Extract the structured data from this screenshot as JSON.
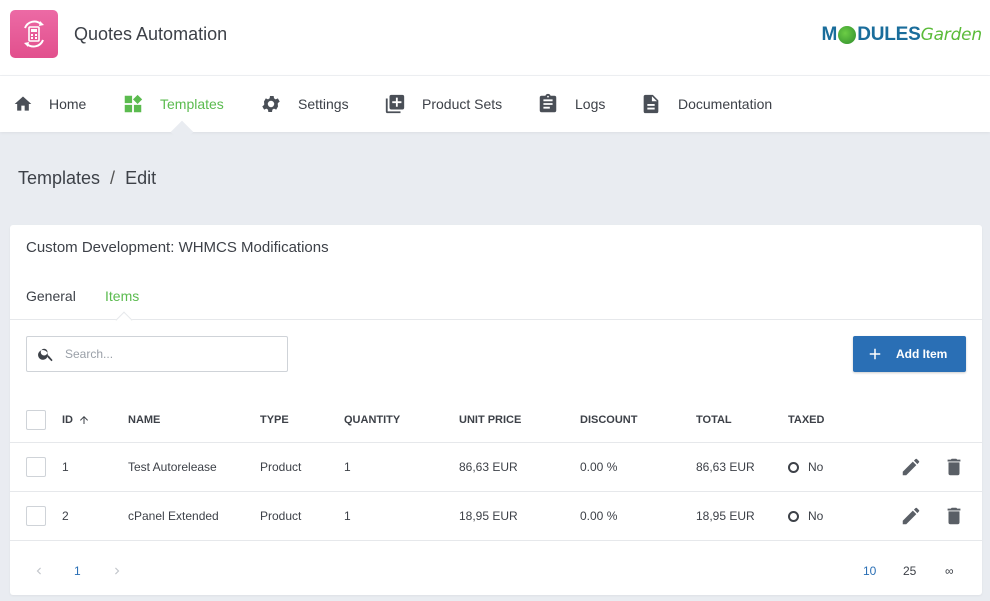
{
  "app": {
    "title": "Quotes Automation",
    "brand_left": "M",
    "brand_mid": "DULES",
    "brand_right": "Garden"
  },
  "nav": [
    {
      "label": "Home",
      "icon": "home-icon",
      "active": false
    },
    {
      "label": "Templates",
      "icon": "templates-icon",
      "active": true
    },
    {
      "label": "Settings",
      "icon": "gear-icon",
      "active": false
    },
    {
      "label": "Product Sets",
      "icon": "library-add-icon",
      "active": false
    },
    {
      "label": "Logs",
      "icon": "clipboard-icon",
      "active": false
    },
    {
      "label": "Documentation",
      "icon": "document-icon",
      "active": false
    }
  ],
  "breadcrumb": {
    "parent": "Templates",
    "separator": "/",
    "current": "Edit"
  },
  "card": {
    "title": "Custom Development: WHMCS Modifications",
    "tabs": [
      {
        "label": "General",
        "active": false
      },
      {
        "label": "Items",
        "active": true
      }
    ]
  },
  "search": {
    "placeholder": "Search...",
    "value": ""
  },
  "add_button": {
    "label": "Add Item"
  },
  "table": {
    "columns": [
      "ID",
      "NAME",
      "TYPE",
      "QUANTITY",
      "UNIT PRICE",
      "DISCOUNT",
      "TOTAL",
      "TAXED"
    ],
    "rows": [
      {
        "id": "1",
        "name": "Test Autorelease",
        "type": "Product",
        "quantity": "1",
        "unit_price": "86,63 EUR",
        "discount": "0.00 %",
        "total": "86,63 EUR",
        "taxed": "No"
      },
      {
        "id": "2",
        "name": "cPanel Extended",
        "type": "Product",
        "quantity": "1",
        "unit_price": "18,95 EUR",
        "discount": "0.00 %",
        "total": "18,95 EUR",
        "taxed": "No"
      }
    ]
  },
  "pagination": {
    "current_page": "1",
    "page_sizes": [
      "10",
      "25",
      "∞"
    ],
    "selected_size": "10"
  },
  "colors": {
    "accent_green": "#5bbb4f",
    "primary_blue": "#2a6fb5",
    "logo_pink": "#e2508d"
  }
}
